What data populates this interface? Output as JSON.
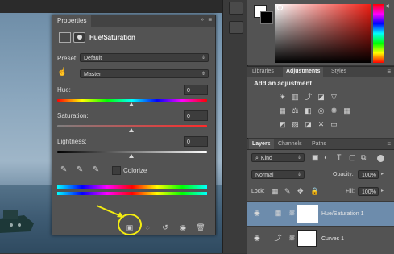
{
  "properties": {
    "tab_label": "Properties",
    "panel_title": "Hue/Saturation",
    "preset_label": "Preset:",
    "preset_value": "Default",
    "channel_value": "Master",
    "hue_label": "Hue:",
    "hue_value": "0",
    "saturation_label": "Saturation:",
    "saturation_value": "0",
    "lightness_label": "Lightness:",
    "lightness_value": "0",
    "colorize_label": "Colorize"
  },
  "adjustments": {
    "tabs": [
      "Libraries",
      "Adjustments",
      "Styles"
    ],
    "active_tab": "Adjustments",
    "heading": "Add an adjustment"
  },
  "layers": {
    "tabs": [
      "Layers",
      "Channels",
      "Paths"
    ],
    "kind_label": "Kind",
    "blend_mode": "Normal",
    "opacity_label": "Opacity:",
    "opacity_value": "100%",
    "lock_label": "Lock:",
    "fill_label": "Fill:",
    "fill_value": "100%",
    "items": [
      {
        "name": "Hue/Saturation 1",
        "selected": true
      },
      {
        "name": "Curves 1",
        "selected": false
      }
    ]
  },
  "colors": {
    "annotation": "#f3ec11",
    "foreground_swatch": "#ffffff",
    "background_swatch": "#000000",
    "selected_layer": "#6d8cac"
  }
}
